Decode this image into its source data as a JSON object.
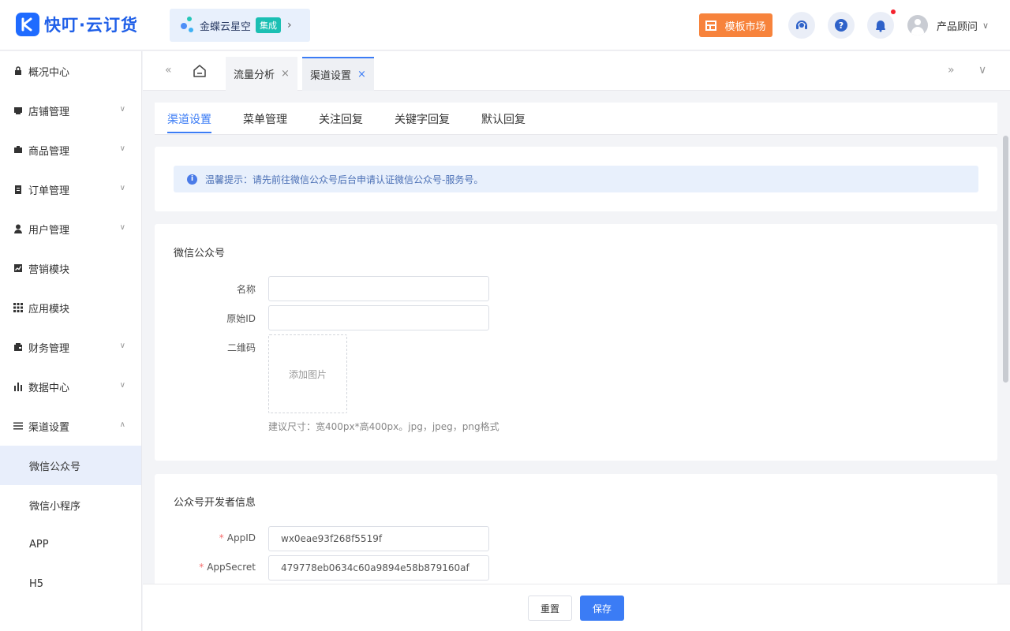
{
  "header": {
    "logo_text": "快叮·云订货",
    "kingdee": {
      "label": "金蝶云星空",
      "badge": "集成",
      "chevron": "›"
    },
    "template_market": "模板市场",
    "user": {
      "name": "产品顾问"
    }
  },
  "sidebar": {
    "items": [
      {
        "label": "概况中心",
        "icon": "lock-icon"
      },
      {
        "label": "店铺管理",
        "icon": "store-icon"
      },
      {
        "label": "商品管理",
        "icon": "box-icon"
      },
      {
        "label": "订单管理",
        "icon": "clipboard-icon"
      },
      {
        "label": "用户管理",
        "icon": "user-icon"
      },
      {
        "label": "营销模块",
        "icon": "chart-line-icon"
      },
      {
        "label": "应用模块",
        "icon": "grid-icon"
      },
      {
        "label": "财务管理",
        "icon": "wallet-icon"
      },
      {
        "label": "数据中心",
        "icon": "bar-chart-icon"
      },
      {
        "label": "渠道设置",
        "icon": "list-icon"
      }
    ],
    "sub_items": [
      {
        "label": "微信公众号",
        "active": true
      },
      {
        "label": "微信小程序"
      },
      {
        "label": "APP"
      },
      {
        "label": "H5"
      }
    ]
  },
  "tabbar": {
    "tabs": [
      {
        "label": "流量分析"
      },
      {
        "label": "渠道设置",
        "active": true
      }
    ],
    "close_glyph": "×"
  },
  "subtabs": [
    "渠道设置",
    "菜单管理",
    "关注回复",
    "关键字回复",
    "默认回复"
  ],
  "tip": "温馨提示：请先前往微信公众号后台申请认证微信公众号-服务号。",
  "wechat_section": {
    "title": "微信公众号",
    "name_label": "名称",
    "name_value": "",
    "origin_id_label": "原始ID",
    "origin_id_value": "",
    "qrcode_label": "二维码",
    "upload_text": "添加图片",
    "hint": "建议尺寸：宽400px*高400px。jpg，jpeg，png格式"
  },
  "dev_section": {
    "title": "公众号开发者信息",
    "appid_label": "AppID",
    "appid_value": "wx0eae93f268f5519f",
    "appsecret_label": "AppSecret",
    "appsecret_value": "479778eb0634c60a9894e58b879160af",
    "required_mark": "*"
  },
  "footer": {
    "reset": "重置",
    "save": "保存"
  },
  "colors": {
    "primary": "#3b7cf5",
    "orange": "#f7833c",
    "teal": "#1bbfb3",
    "notify_dot": "#f5222d"
  }
}
